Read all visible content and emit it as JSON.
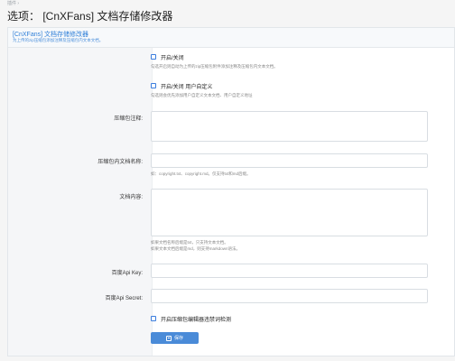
{
  "breadcrumb": "插件 ›",
  "page_title": "选项：  [CnXFans] 文档存储修改器",
  "panel": {
    "title": "[CnXFans] 文档存储修改器",
    "subtitle": "为上传的zip压缩包添加注释及压缩包内文本文档。"
  },
  "options": {
    "toggle1": {
      "label": "开启/关闭",
      "help": "勾选开启则自动为上传的zip压缩包附件添加注释及压缩包内文本文档。"
    },
    "toggle2": {
      "label": "开启/关闭 用户自定义",
      "help": "勾选则会优先添加用户自定义文本文档、用户自定义地址"
    },
    "comment": {
      "label": "压缩包注释:",
      "value": ""
    },
    "doc_name": {
      "label": "压缩包内文档名称:",
      "value": "",
      "help": "如：copyright.txt、copyright.md。仅支持txt和md后缀。"
    },
    "doc_content": {
      "label": "文档内容:",
      "value": "",
      "help1": "如果文档名称后缀是txt，只支持文本文档。",
      "help2": "如果文本文档后缀是md，则支持markdown语法。"
    },
    "api_key": {
      "label": "百度Api Key:",
      "value": ""
    },
    "api_secret": {
      "label": "百度Api Secret:",
      "value": ""
    },
    "toggle3": {
      "label": "开启压缩包编辑器违禁词检测"
    }
  },
  "save_label": "保存",
  "icons": {
    "save": "save-icon",
    "checkbox": "checkbox-icon"
  }
}
